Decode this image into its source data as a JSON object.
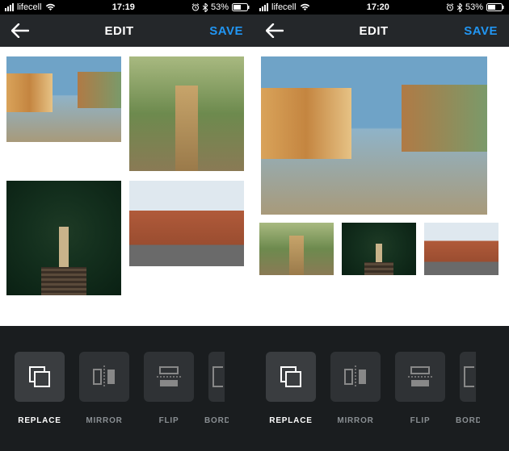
{
  "phones": [
    {
      "status": {
        "carrier": "lifecell",
        "time": "17:19",
        "battery": "53%"
      },
      "nav": {
        "title": "EDIT",
        "save_label": "SAVE"
      },
      "tools": [
        {
          "key": "replace",
          "label": "REPLACE",
          "selected": true
        },
        {
          "key": "mirror",
          "label": "MIRROR",
          "selected": false
        },
        {
          "key": "flip",
          "label": "FLIP",
          "selected": false
        },
        {
          "key": "border",
          "label": "BORD",
          "selected": false,
          "partial": true
        }
      ]
    },
    {
      "status": {
        "carrier": "lifecell",
        "time": "17:20",
        "battery": "53%"
      },
      "nav": {
        "title": "EDIT",
        "save_label": "SAVE"
      },
      "tools": [
        {
          "key": "replace",
          "label": "REPLACE",
          "selected": true
        },
        {
          "key": "mirror",
          "label": "MIRROR",
          "selected": false
        },
        {
          "key": "flip",
          "label": "FLIP",
          "selected": false
        },
        {
          "key": "border",
          "label": "BORD",
          "selected": false,
          "partial": true
        }
      ]
    }
  ],
  "icons": {
    "alarm": "⏰",
    "bluetooth": "✱",
    "wifi": "wifi-icon",
    "battery": "battery-icon"
  }
}
